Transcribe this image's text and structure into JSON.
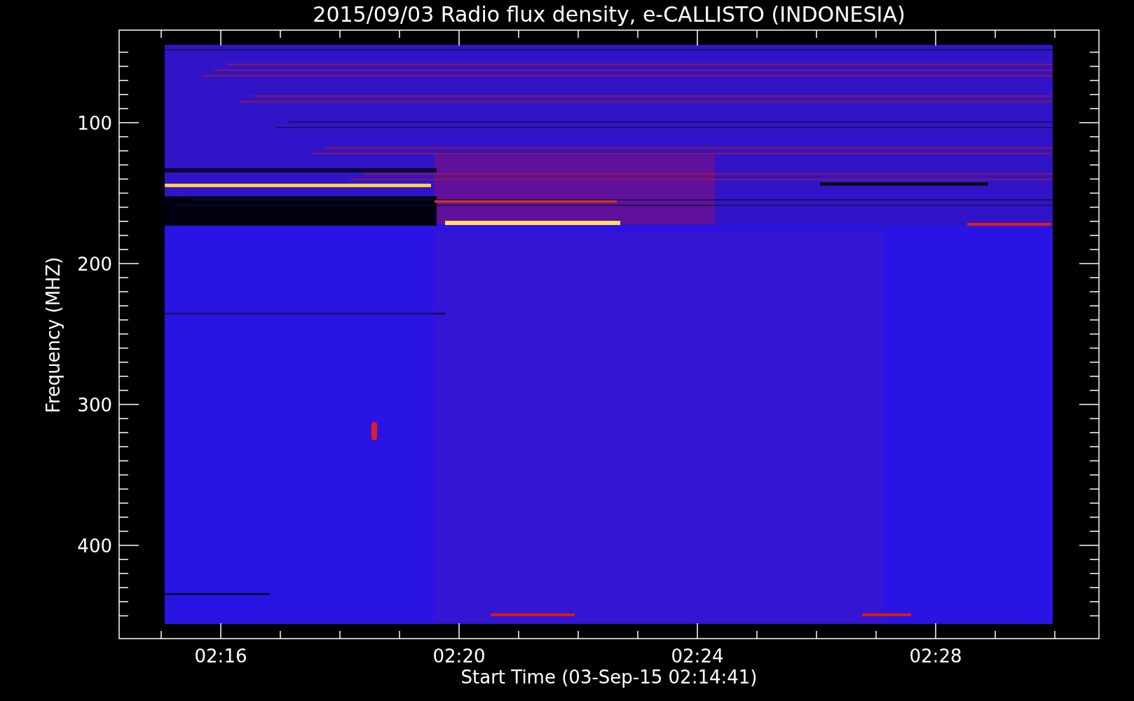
{
  "plot": {
    "title": "2015/09/03  Radio flux density, e-CALLISTO (INDONESIA)",
    "y_label": "Frequency (MHZ)",
    "y_tick_labels": [
      "100",
      "200",
      "300",
      "400"
    ],
    "x_label": "Start Time (03-Sep-15 02:14:41)",
    "x_tick_labels": [
      "02:16",
      "02:20",
      "02:24",
      "02:28"
    ]
  }
}
